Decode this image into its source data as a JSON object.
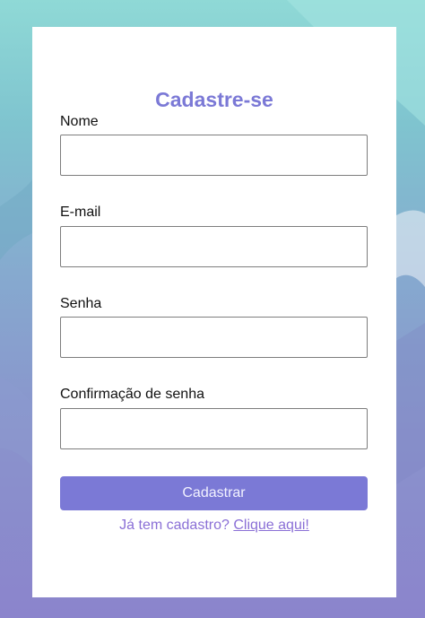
{
  "form": {
    "title": "Cadastre-se",
    "fields": [
      {
        "label": "Nome",
        "value": "",
        "placeholder": ""
      },
      {
        "label": "E-mail",
        "value": "",
        "placeholder": ""
      },
      {
        "label": "Senha",
        "value": "",
        "placeholder": ""
      },
      {
        "label": "Confirmação de senha",
        "value": "",
        "placeholder": ""
      }
    ],
    "submit_label": "Cadastrar",
    "login_prompt": "Já tem cadastro?",
    "login_link": "Clique aqui!"
  },
  "colors": {
    "accent": "#7b79d6",
    "link": "#8a6fd6",
    "card_background": "#ffffff",
    "background_top": "#8fd9d6",
    "background_bottom": "#8b84cc"
  }
}
